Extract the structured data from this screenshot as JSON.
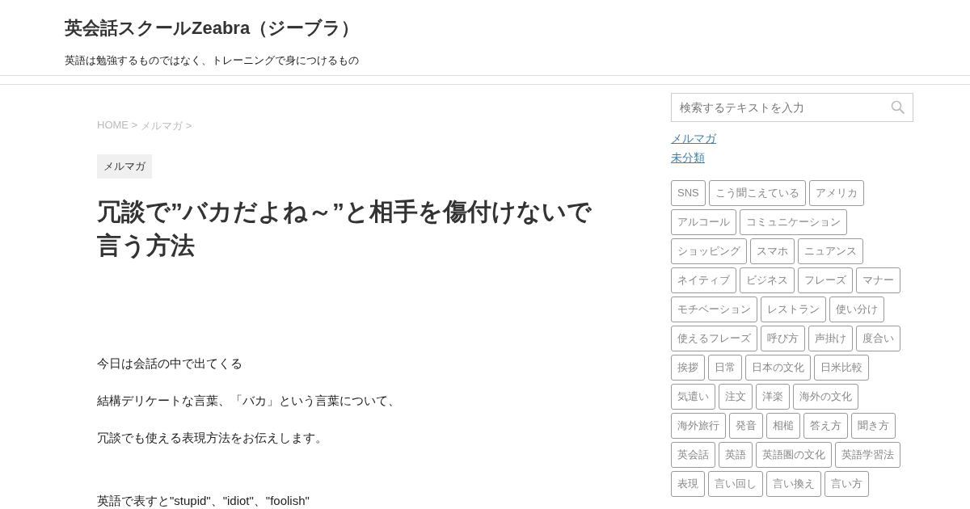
{
  "site": {
    "title": "英会話スクールZeabra（ジーブラ）",
    "tagline": "英語は勉強するものではなく、トレーニングで身につけるもの"
  },
  "breadcrumb": [
    "HOME >",
    "メルマガ >"
  ],
  "article": {
    "category": "メルマガ",
    "title": "冗談で”バカだよね～”と相手を傷付けないで言う方法",
    "paragraphs": [
      "今日は会話の中で出てくる",
      "結構デリケートな言葉、「バカ」という言葉について、",
      "冗談でも使える表現方法をお伝えします。"
    ],
    "last_line": "英語で表すと\"stupid\"、\"idiot\"、\"foolish\""
  },
  "sidebar": {
    "search": {
      "placeholder": "検索するテキストを入力"
    },
    "categories": [
      "メルマガ",
      "未分類"
    ],
    "tags": [
      "SNS",
      "こう聞こえている",
      "アメリカ",
      "アルコール",
      "コミュニケーション",
      "ショッピング",
      "スマホ",
      "ニュアンス",
      "ネイティブ",
      "ビジネス",
      "フレーズ",
      "マナー",
      "モチベーション",
      "レストラン",
      "使い分け",
      "使えるフレーズ",
      "呼び方",
      "声掛け",
      "度合い",
      "挨拶",
      "日常",
      "日本の文化",
      "日米比較",
      "気遣い",
      "注文",
      "洋楽",
      "海外の文化",
      "海外旅行",
      "発音",
      "相槌",
      "答え方",
      "聞き方",
      "英会話",
      "英語",
      "英語圏の文化",
      "英語学習法",
      "表現",
      "言い回し",
      "言い換え",
      "言い方"
    ]
  }
}
